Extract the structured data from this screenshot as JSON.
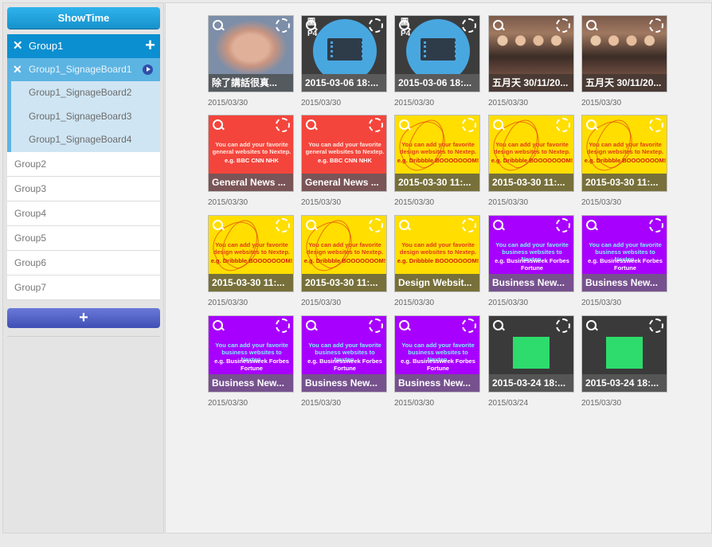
{
  "sidebar": {
    "showtime_label": "ShowTime",
    "active_group": {
      "label": "Group1",
      "close_icon": "✕",
      "add_icon": "+"
    },
    "active_board": {
      "label": "Group1_SignageBoard1",
      "close_icon": "✕"
    },
    "boards": [
      "Group1_SignageBoard2",
      "Group1_SignageBoard3",
      "Group1_SignageBoard4"
    ],
    "groups": [
      "Group2",
      "Group3",
      "Group4",
      "Group5",
      "Group6",
      "Group7"
    ],
    "add_group_icon": "+"
  },
  "colors": {
    "accent": "#0b8fd0",
    "sub_active": "#5cb4e2",
    "sub_bg": "#cfe5f3",
    "add_btn": "#4e5dc4",
    "red": "#f4453c",
    "yellow": "#ffde00",
    "purple": "#a800ff",
    "dark": "#3a3a3a"
  },
  "tiles": [
    {
      "caption": "除了講話很真...",
      "date": "2015/03/30",
      "kind": "face",
      "bar": "#555a5e"
    },
    {
      "caption": "2015-03-06 18:...",
      "date": "2015/03/30",
      "kind": "film",
      "bar": "#5a5a5a",
      "badge": "圖P4"
    },
    {
      "caption": "2015-03-06 18:...",
      "date": "2015/03/30",
      "kind": "film",
      "bar": "#5a5a5a",
      "badge": "圖P4"
    },
    {
      "caption": "五月天 30/11/20...",
      "date": "2015/03/30",
      "kind": "people",
      "bar": "#4a3a34"
    },
    {
      "caption": "五月天 30/11/20...",
      "date": "2015/03/30",
      "kind": "people",
      "bar": "#4a3a34"
    },
    {
      "caption": "General News ...",
      "date": "2015/03/30",
      "kind": "red",
      "bar": "#7a5456",
      "msg": "You can add your favorite general websites to Nextep.",
      "eg": "e.g. BBC CNN NHK"
    },
    {
      "caption": "General News ...",
      "date": "2015/03/30",
      "kind": "red",
      "bar": "#7a5456",
      "msg": "You can add your favorite general websites to Nextep.",
      "eg": "e.g. BBC CNN NHK"
    },
    {
      "caption": "2015-03-30 11:...",
      "date": "2015/03/30",
      "kind": "yellow",
      "bar": "#77703a",
      "msg": "You can add your favorite design websites to Nextep.",
      "eg": "e.g. Dribbble BOOOOOOOM!"
    },
    {
      "caption": "2015-03-30 11:...",
      "date": "2015/03/30",
      "kind": "yellow",
      "bar": "#77703a",
      "msg": "You can add your favorite design websites to Nextep.",
      "eg": "e.g. Dribbble BOOOOOOOM!"
    },
    {
      "caption": "2015-03-30 11:...",
      "date": "2015/03/30",
      "kind": "yellow",
      "bar": "#77703a",
      "msg": "You can add your favorite design websites to Nextep.",
      "eg": "e.g. Dribbble BOOOOOOOM!"
    },
    {
      "caption": "2015-03-30 11:...",
      "date": "2015/03/30",
      "kind": "yellow",
      "bar": "#77703a",
      "msg": "You can add your favorite design websites to Nextep.",
      "eg": "e.g. Dribbble BOOOOOOOM!"
    },
    {
      "caption": "2015-03-30 11:...",
      "date": "2015/03/30",
      "kind": "yellow",
      "bar": "#77703a",
      "msg": "You can add your favorite design websites to Nextep.",
      "eg": "e.g. Dribbble BOOOOOOOM!"
    },
    {
      "caption": "Design Websit...",
      "date": "2015/03/30",
      "kind": "yellow-plain",
      "bar": "#77703a",
      "msg": "You can add your favorite design websites to Nextep.",
      "eg": "e.g. Dribbble BOOOOOOOM!"
    },
    {
      "caption": "Business New...",
      "date": "2015/03/30",
      "kind": "purple",
      "bar": "#76518e",
      "msg": "You can add your favorite business websites to Nextep.",
      "eg": "e.g. Businessweek Forbes Fortune"
    },
    {
      "caption": "Business New...",
      "date": "2015/03/30",
      "kind": "purple",
      "bar": "#76518e",
      "msg": "You can add your favorite business websites to Nextep.",
      "eg": "e.g. Businessweek Forbes Fortune"
    },
    {
      "caption": "Business New...",
      "date": "2015/03/30",
      "kind": "purple",
      "bar": "#76518e",
      "msg": "You can add your favorite business websites to Nextep.",
      "eg": "e.g. Businessweek Forbes Fortune"
    },
    {
      "caption": "Business New...",
      "date": "2015/03/30",
      "kind": "purple",
      "bar": "#76518e",
      "msg": "You can add your favorite business websites to Nextep.",
      "eg": "e.g. Businessweek Forbes Fortune"
    },
    {
      "caption": "Business New...",
      "date": "2015/03/30",
      "kind": "purple",
      "bar": "#76518e",
      "msg": "You can add your favorite business websites to Nextep.",
      "eg": "e.g. Businessweek Forbes Fortune"
    },
    {
      "caption": "2015-03-24 18:...",
      "date": "2015/03/24",
      "kind": "board",
      "bar": "#555555"
    },
    {
      "caption": "2015-03-24 18:...",
      "date": "2015/03/30",
      "kind": "board",
      "bar": "#555555"
    }
  ]
}
